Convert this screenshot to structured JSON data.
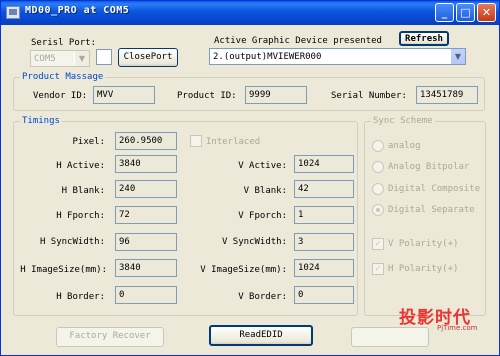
{
  "window": {
    "title": "MD00_PRO at COM5"
  },
  "titlebar_buttons": {
    "minimize": "_",
    "maximize": "□",
    "close": "✕"
  },
  "serial": {
    "label": "Serisl Port:",
    "port_value": "COM5",
    "close_port_label": "ClosePort"
  },
  "graphic_device": {
    "label": "Active Graphic Device presented",
    "refresh_label": "Refresh",
    "selected": "2.(output)MVIEWER000"
  },
  "product": {
    "group_title": "Product Massage",
    "vendor_label": "Vendor ID:",
    "vendor_value": "MVV",
    "product_label": "Product ID:",
    "product_value": "9999",
    "serial_label": "Serial Number:",
    "serial_value": "13451789"
  },
  "timings": {
    "group_title": "Timings",
    "pixel_label": "Pixel:",
    "pixel_value": "260.9500",
    "interlaced_label": "Interlaced",
    "h_active_label": "H Active:",
    "h_active_value": "3840",
    "v_active_label": "V Active:",
    "v_active_value": "1024",
    "h_blank_label": "H Blank:",
    "h_blank_value": "240",
    "v_blank_label": "V Blank:",
    "v_blank_value": "42",
    "h_fporch_label": "H Fporch:",
    "h_fporch_value": "72",
    "v_fporch_label": "V Fporch:",
    "v_fporch_value": "1",
    "h_syncwidth_label": "H SyncWidth:",
    "h_syncwidth_value": "96",
    "v_syncwidth_label": "V SyncWidth:",
    "v_syncwidth_value": "3",
    "h_imagesize_label": "H ImageSize(mm):",
    "h_imagesize_value": "3840",
    "v_imagesize_label": "V ImageSize(mm):",
    "v_imagesize_value": "1024",
    "h_border_label": "H Border:",
    "h_border_value": "0",
    "v_border_label": "V Border:",
    "v_border_value": "0"
  },
  "sync_scheme": {
    "group_title": "Sync Scheme",
    "analog": "analog",
    "analog_bipolar": "Analog Bitpolar",
    "digital_composite": "Digital Composite",
    "digital_separate": "Digital Separate",
    "v_polarity": "V Polarity(+)",
    "h_polarity": "H Polarity(+)"
  },
  "actions": {
    "factory_recover_label": "Factory Recover",
    "read_edid_label": "ReadEDID"
  },
  "watermark": {
    "main": "投影时代",
    "sub": "PjTime.com"
  }
}
